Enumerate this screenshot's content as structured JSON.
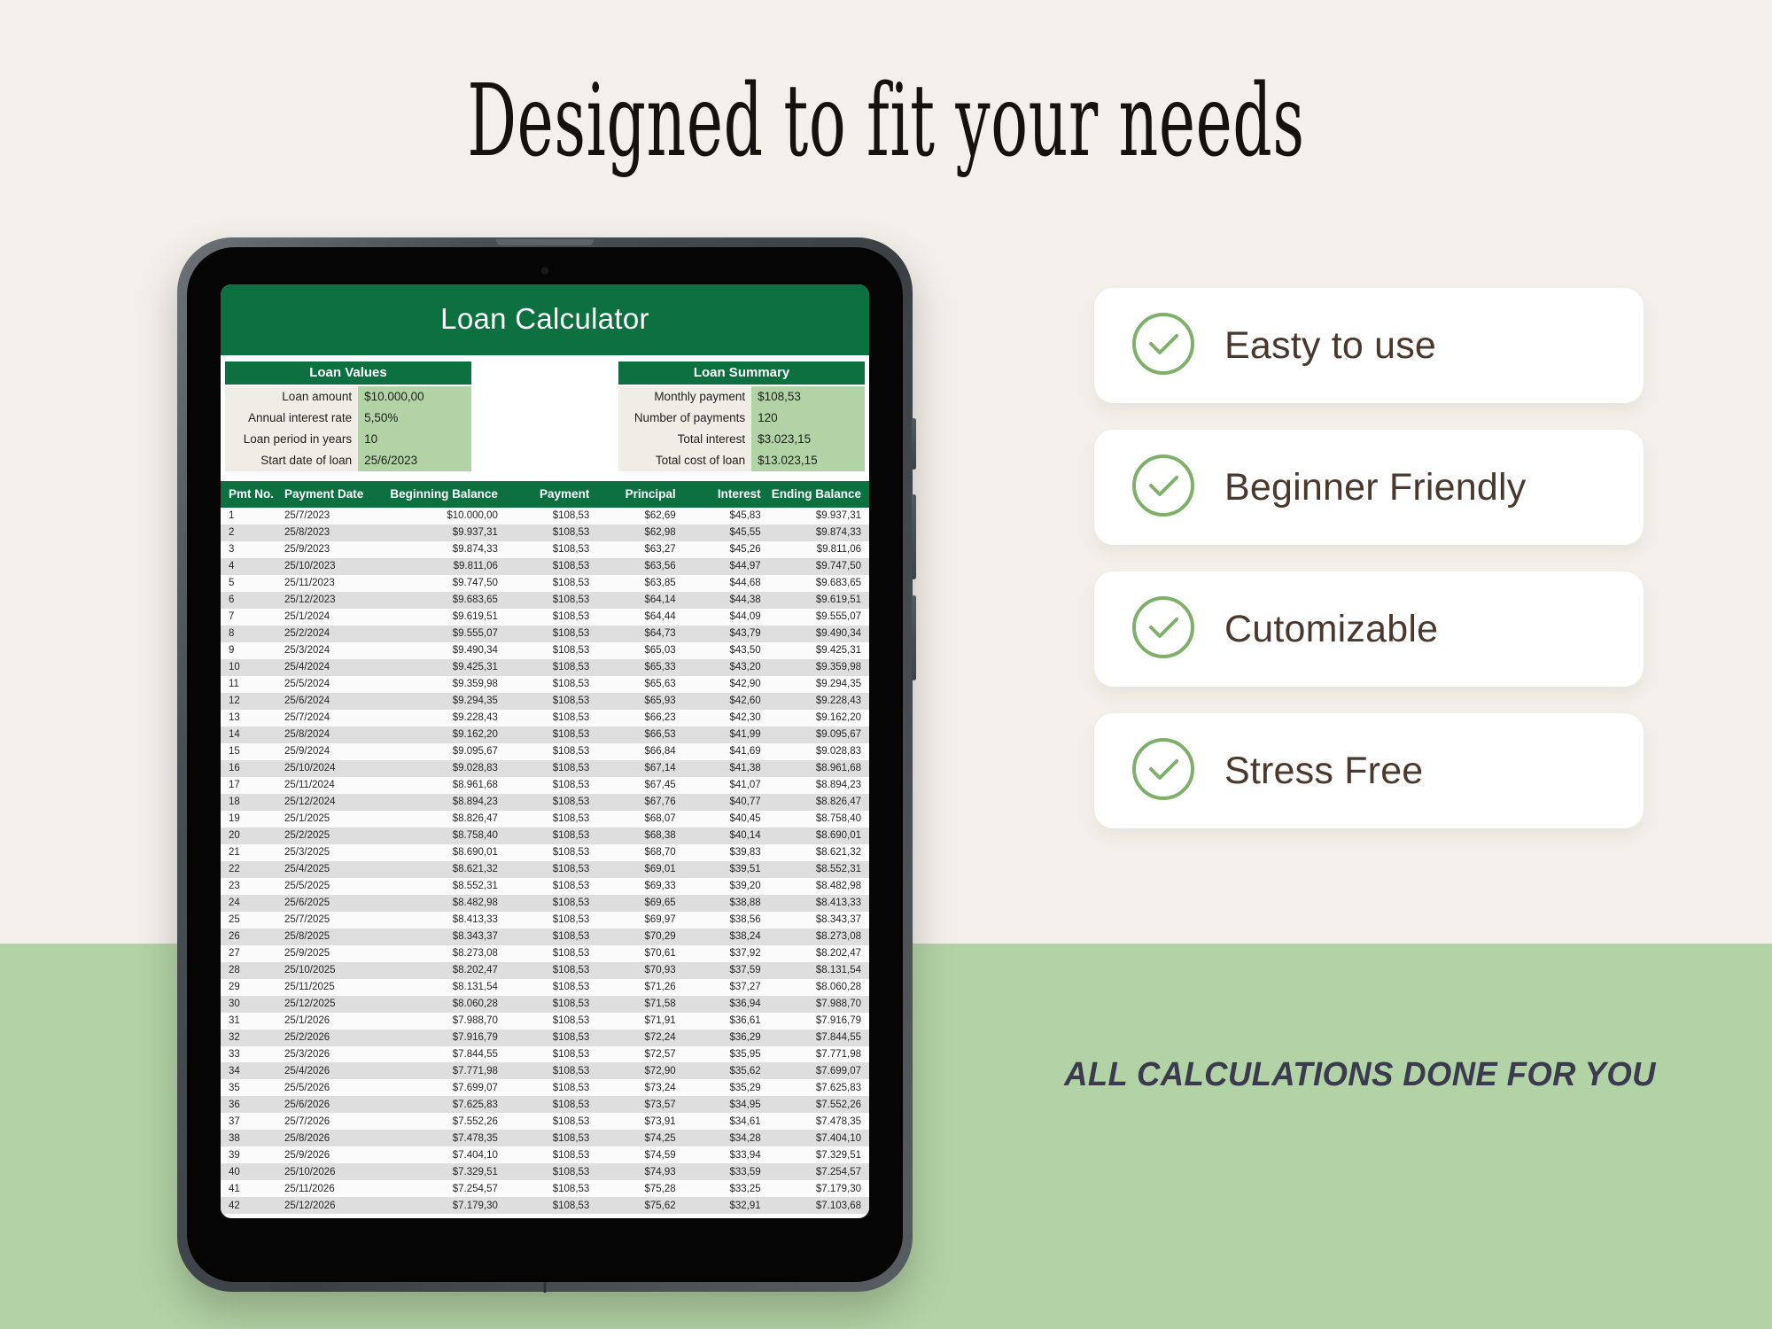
{
  "page": {
    "headline": "Designed to fit your needs",
    "tagline": "ALL CALCULATIONS DONE FOR YOU",
    "colors": {
      "background_top": "#F3F0EB",
      "background_bottom": "#B2D3A5",
      "sheet_header_green": "#0C7040",
      "sheet_value_green": "#B2D3A5",
      "card_white": "#FFFFFF",
      "check_green": "#7FB06B",
      "label_brown": "#4A382C",
      "tagline_navy": "#3B3A4F"
    }
  },
  "spreadsheet": {
    "title": "Loan Calculator",
    "loan_values": {
      "heading": "Loan Values",
      "rows": [
        {
          "label": "Loan amount",
          "value": "$10.000,00"
        },
        {
          "label": "Annual interest rate",
          "value": "5,50%"
        },
        {
          "label": "Loan period in years",
          "value": "10"
        },
        {
          "label": "Start date of loan",
          "value": "25/6/2023"
        }
      ]
    },
    "loan_summary": {
      "heading": "Loan Summary",
      "rows": [
        {
          "label": "Monthly payment",
          "value": "$108,53"
        },
        {
          "label": "Number of payments",
          "value": "120"
        },
        {
          "label": "Total interest",
          "value": "$3.023,15"
        },
        {
          "label": "Total cost of loan",
          "value": "$13.023,15"
        }
      ]
    },
    "table": {
      "columns": [
        "Pmt No.",
        "Payment Date",
        "Beginning Balance",
        "Payment",
        "Principal",
        "Interest",
        "Ending Balance"
      ],
      "rows": [
        [
          "1",
          "25/7/2023",
          "$10.000,00",
          "$108,53",
          "$62,69",
          "$45,83",
          "$9.937,31"
        ],
        [
          "2",
          "25/8/2023",
          "$9.937,31",
          "$108,53",
          "$62,98",
          "$45,55",
          "$9.874,33"
        ],
        [
          "3",
          "25/9/2023",
          "$9.874,33",
          "$108,53",
          "$63,27",
          "$45,26",
          "$9.811,06"
        ],
        [
          "4",
          "25/10/2023",
          "$9.811,06",
          "$108,53",
          "$63,56",
          "$44,97",
          "$9.747,50"
        ],
        [
          "5",
          "25/11/2023",
          "$9.747,50",
          "$108,53",
          "$63,85",
          "$44,68",
          "$9.683,65"
        ],
        [
          "6",
          "25/12/2023",
          "$9.683,65",
          "$108,53",
          "$64,14",
          "$44,38",
          "$9.619,51"
        ],
        [
          "7",
          "25/1/2024",
          "$9.619,51",
          "$108,53",
          "$64,44",
          "$44,09",
          "$9.555,07"
        ],
        [
          "8",
          "25/2/2024",
          "$9.555,07",
          "$108,53",
          "$64,73",
          "$43,79",
          "$9.490,34"
        ],
        [
          "9",
          "25/3/2024",
          "$9.490,34",
          "$108,53",
          "$65,03",
          "$43,50",
          "$9.425,31"
        ],
        [
          "10",
          "25/4/2024",
          "$9.425,31",
          "$108,53",
          "$65,33",
          "$43,20",
          "$9.359,98"
        ],
        [
          "11",
          "25/5/2024",
          "$9.359,98",
          "$108,53",
          "$65,63",
          "$42,90",
          "$9.294,35"
        ],
        [
          "12",
          "25/6/2024",
          "$9.294,35",
          "$108,53",
          "$65,93",
          "$42,60",
          "$9.228,43"
        ],
        [
          "13",
          "25/7/2024",
          "$9.228,43",
          "$108,53",
          "$66,23",
          "$42,30",
          "$9.162,20"
        ],
        [
          "14",
          "25/8/2024",
          "$9.162,20",
          "$108,53",
          "$66,53",
          "$41,99",
          "$9.095,67"
        ],
        [
          "15",
          "25/9/2024",
          "$9.095,67",
          "$108,53",
          "$66,84",
          "$41,69",
          "$9.028,83"
        ],
        [
          "16",
          "25/10/2024",
          "$9.028,83",
          "$108,53",
          "$67,14",
          "$41,38",
          "$8.961,68"
        ],
        [
          "17",
          "25/11/2024",
          "$8.961,68",
          "$108,53",
          "$67,45",
          "$41,07",
          "$8.894,23"
        ],
        [
          "18",
          "25/12/2024",
          "$8.894,23",
          "$108,53",
          "$67,76",
          "$40,77",
          "$8.826,47"
        ],
        [
          "19",
          "25/1/2025",
          "$8.826,47",
          "$108,53",
          "$68,07",
          "$40,45",
          "$8.758,40"
        ],
        [
          "20",
          "25/2/2025",
          "$8.758,40",
          "$108,53",
          "$68,38",
          "$40,14",
          "$8.690,01"
        ],
        [
          "21",
          "25/3/2025",
          "$8.690,01",
          "$108,53",
          "$68,70",
          "$39,83",
          "$8.621,32"
        ],
        [
          "22",
          "25/4/2025",
          "$8.621,32",
          "$108,53",
          "$69,01",
          "$39,51",
          "$8.552,31"
        ],
        [
          "23",
          "25/5/2025",
          "$8.552,31",
          "$108,53",
          "$69,33",
          "$39,20",
          "$8.482,98"
        ],
        [
          "24",
          "25/6/2025",
          "$8.482,98",
          "$108,53",
          "$69,65",
          "$38,88",
          "$8.413,33"
        ],
        [
          "25",
          "25/7/2025",
          "$8.413,33",
          "$108,53",
          "$69,97",
          "$38,56",
          "$8.343,37"
        ],
        [
          "26",
          "25/8/2025",
          "$8.343,37",
          "$108,53",
          "$70,29",
          "$38,24",
          "$8.273,08"
        ],
        [
          "27",
          "25/9/2025",
          "$8.273,08",
          "$108,53",
          "$70,61",
          "$37,92",
          "$8.202,47"
        ],
        [
          "28",
          "25/10/2025",
          "$8.202,47",
          "$108,53",
          "$70,93",
          "$37,59",
          "$8.131,54"
        ],
        [
          "29",
          "25/11/2025",
          "$8.131,54",
          "$108,53",
          "$71,26",
          "$37,27",
          "$8.060,28"
        ],
        [
          "30",
          "25/12/2025",
          "$8.060,28",
          "$108,53",
          "$71,58",
          "$36,94",
          "$7.988,70"
        ],
        [
          "31",
          "25/1/2026",
          "$7.988,70",
          "$108,53",
          "$71,91",
          "$36,61",
          "$7.916,79"
        ],
        [
          "32",
          "25/2/2026",
          "$7.916,79",
          "$108,53",
          "$72,24",
          "$36,29",
          "$7.844,55"
        ],
        [
          "33",
          "25/3/2026",
          "$7.844,55",
          "$108,53",
          "$72,57",
          "$35,95",
          "$7.771,98"
        ],
        [
          "34",
          "25/4/2026",
          "$7.771,98",
          "$108,53",
          "$72,90",
          "$35,62",
          "$7.699,07"
        ],
        [
          "35",
          "25/5/2026",
          "$7.699,07",
          "$108,53",
          "$73,24",
          "$35,29",
          "$7.625,83"
        ],
        [
          "36",
          "25/6/2026",
          "$7.625,83",
          "$108,53",
          "$73,57",
          "$34,95",
          "$7.552,26"
        ],
        [
          "37",
          "25/7/2026",
          "$7.552,26",
          "$108,53",
          "$73,91",
          "$34,61",
          "$7.478,35"
        ],
        [
          "38",
          "25/8/2026",
          "$7.478,35",
          "$108,53",
          "$74,25",
          "$34,28",
          "$7.404,10"
        ],
        [
          "39",
          "25/9/2026",
          "$7.404,10",
          "$108,53",
          "$74,59",
          "$33,94",
          "$7.329,51"
        ],
        [
          "40",
          "25/10/2026",
          "$7.329,51",
          "$108,53",
          "$74,93",
          "$33,59",
          "$7.254,57"
        ],
        [
          "41",
          "25/11/2026",
          "$7.254,57",
          "$108,53",
          "$75,28",
          "$33,25",
          "$7.179,30"
        ],
        [
          "42",
          "25/12/2026",
          "$7.179,30",
          "$108,53",
          "$75,62",
          "$32,91",
          "$7.103,68"
        ]
      ]
    }
  },
  "features": {
    "icon": "check-circle-icon",
    "cards": [
      {
        "label": "Easty to use"
      },
      {
        "label": "Beginner Friendly"
      },
      {
        "label": "Cutomizable"
      },
      {
        "label": "Stress Free"
      }
    ]
  }
}
